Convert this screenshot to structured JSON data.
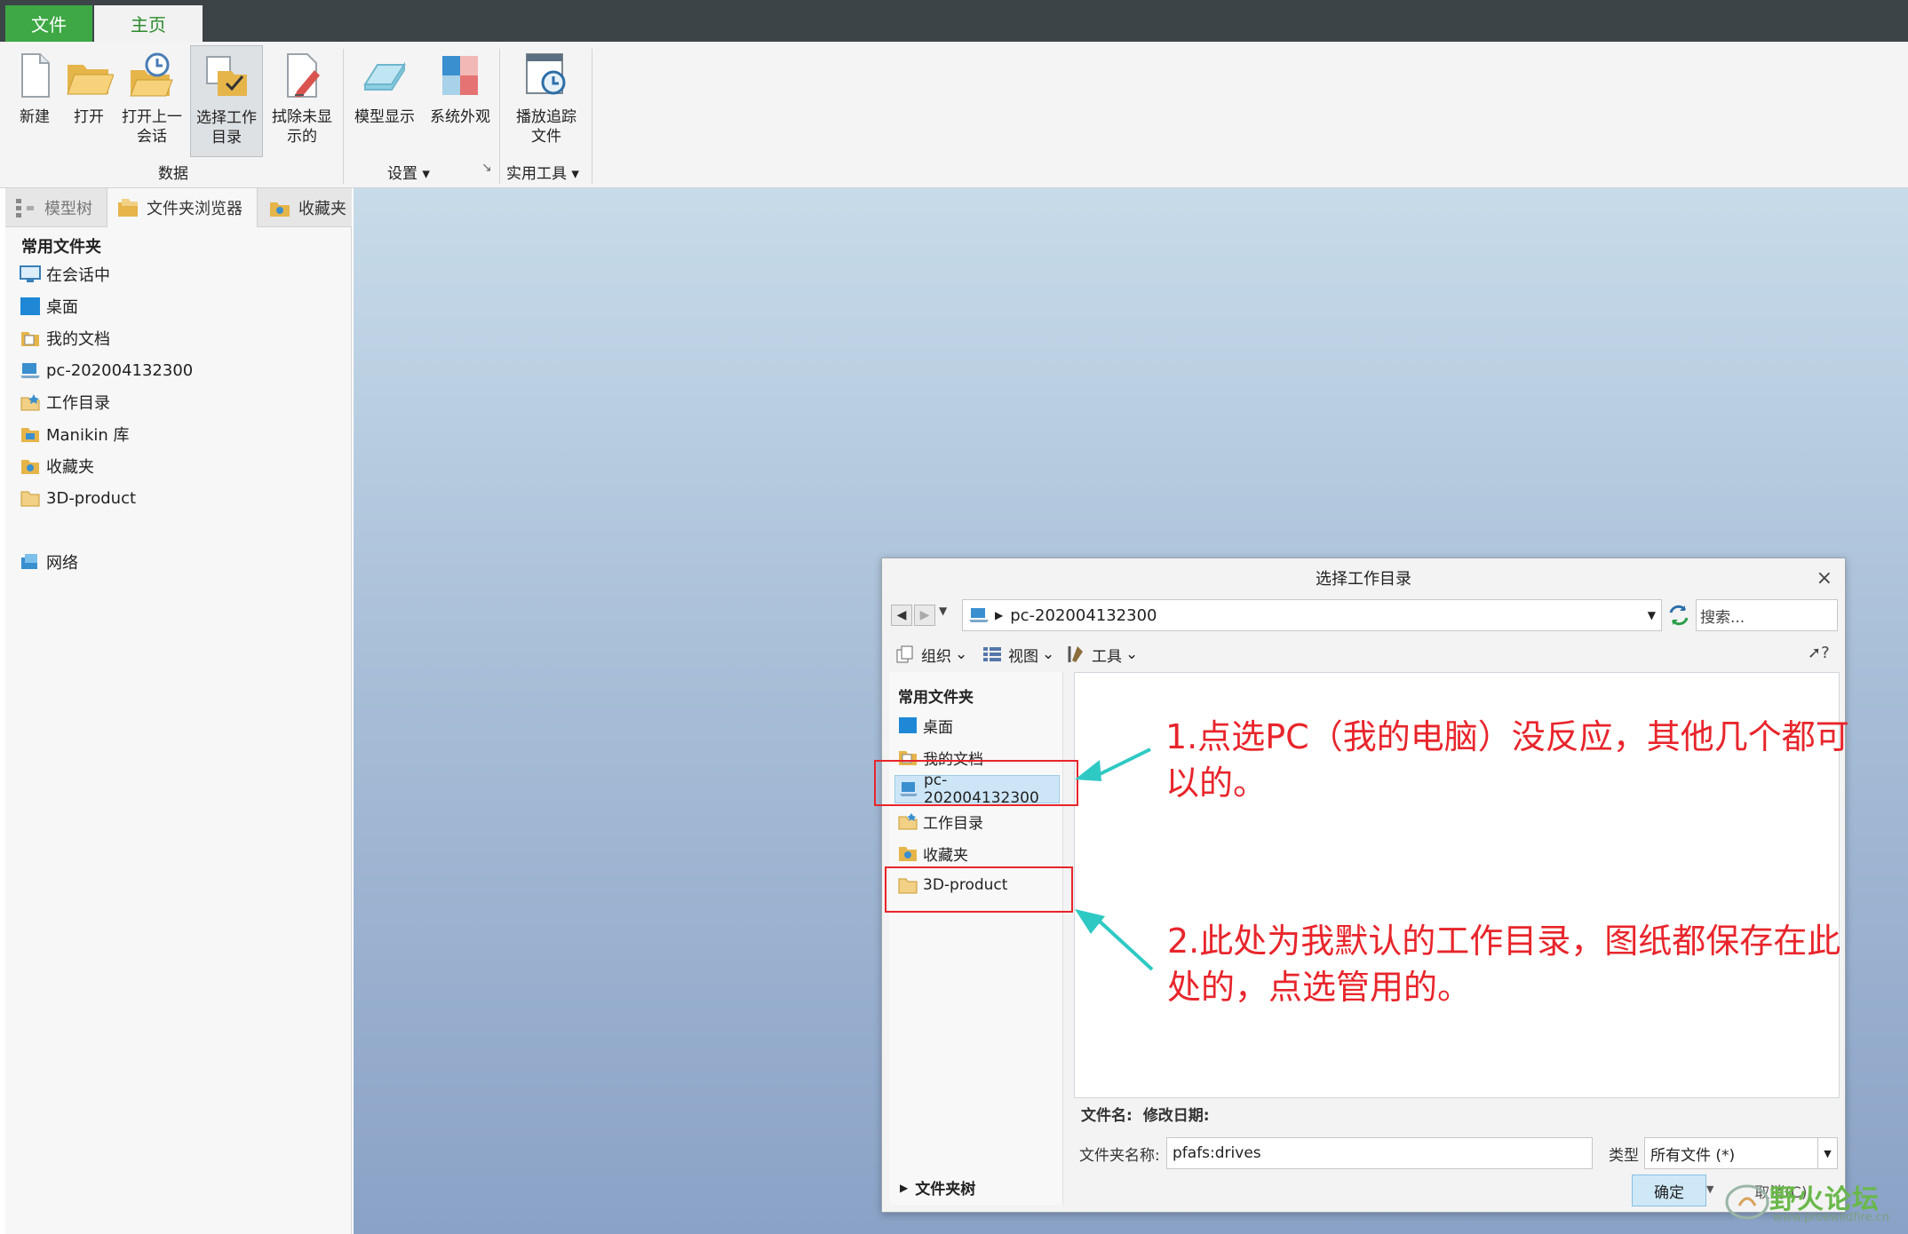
{
  "tabs": {
    "file": "文件",
    "home": "主页"
  },
  "ribbon": {
    "buttons": {
      "new": "新建",
      "open": "打开",
      "open_last_l1": "打开上一",
      "open_last_l2": "会话",
      "select_wd_l1": "选择工作",
      "select_wd_l2": "目录",
      "erase_l1": "拭除未显",
      "erase_l2": "示的",
      "model_display": "模型显示",
      "system_appearance": "系统外观",
      "play_trail_l1": "播放追踪",
      "play_trail_l2": "文件"
    },
    "groups": {
      "data": "数据",
      "settings": "设置",
      "utilities": "实用工具"
    }
  },
  "left_panel": {
    "tabs": {
      "model_tree": "模型树",
      "folder_browser": "文件夹浏览器",
      "favorites": "收藏夹"
    },
    "common_heading": "常用文件夹",
    "items": [
      "在会话中",
      "桌面",
      "我的文档",
      "pc-202004132300",
      "工作目录",
      "Manikin 库",
      "收藏夹",
      "3D-product"
    ],
    "network": "网络"
  },
  "dialog": {
    "title": "选择工作目录",
    "close": "×",
    "path": "pc-202004132300",
    "search_placeholder": "搜索...",
    "toolbar": {
      "organize": "组织",
      "views": "视图",
      "tools": "工具"
    },
    "help": "?",
    "sidebar": {
      "heading": "常用文件夹",
      "items": [
        "桌面",
        "我的文档",
        "pc-202004132300",
        "工作目录",
        "收藏夹",
        "3D-product"
      ]
    },
    "columns": {
      "filename": "文件名:",
      "modified": "修改日期:"
    },
    "folder_name_label": "文件夹名称:",
    "folder_name_value": "pfafs:drives",
    "type_label": "类型",
    "type_value": "所有文件 (*)",
    "ok": "确定",
    "cancel": "取消(C)",
    "folder_tree": "文件夹树"
  },
  "annotations": {
    "note1_l1": "1.点选PC（我的电脑）没反应，其他几个都可",
    "note1_l2": "以的。",
    "note2_l1": "2.此处为我默认的工作目录，图纸都保存在此",
    "note2_l2": "处的，点选管用的。"
  },
  "watermark": {
    "main": "野火论坛",
    "sub": "www.proewildfire.cn"
  },
  "colors": {
    "file_tab": "#3ea845",
    "annotation": "#e8252b",
    "arrow": "#2fc9c4",
    "selection": "#cde6f7"
  },
  "icons": [
    "new-file-icon",
    "open-folder-icon",
    "open-session-icon",
    "select-directory-icon",
    "erase-icon",
    "model-display-icon",
    "system-appearance-icon",
    "play-trail-icon",
    "model-tree-icon",
    "folder-browser-icon",
    "favorites-icon",
    "monitor-icon",
    "desktop-icon",
    "documents-icon",
    "computer-icon",
    "working-directory-icon",
    "library-icon",
    "folder-icon",
    "network-icon",
    "back-icon",
    "forward-icon",
    "refresh-icon",
    "help-cursor-icon"
  ]
}
